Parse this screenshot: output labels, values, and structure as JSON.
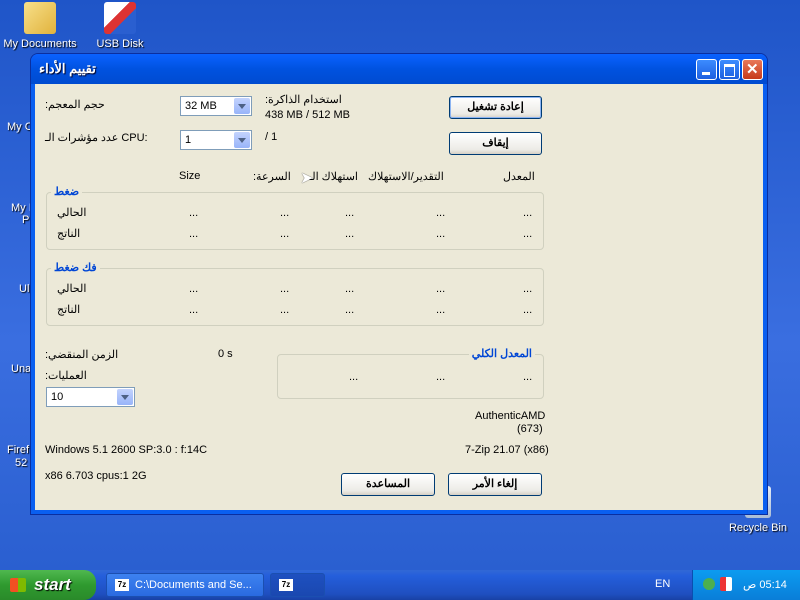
{
  "desktop": {
    "icons": [
      {
        "label": "My Documents"
      },
      {
        "label": "USB Disk"
      }
    ],
    "edge_labels": [
      "My C",
      "My I",
      "P",
      "Ul",
      "Una",
      "Firef",
      "52"
    ],
    "recycle_bin": "Recycle Bin"
  },
  "window": {
    "title": "تقييم الأداء",
    "dictionary_size_label": "حجم المعجم:",
    "dictionary_size_value": "32 MB",
    "memory_usage_label": "استخدام الذاكرة:",
    "memory_usage_value": "438 MB / 512 MB",
    "cpu_threads_label": "عدد مؤشرات الـ CPU:",
    "cpu_threads_value": "1",
    "cpu_threads_max": "/ 1",
    "restart_button": "إعادة تشغيل",
    "stop_button": "إيقاف",
    "columns": {
      "size": "Size",
      "speed": "السرعة:",
      "cpu_usage": "استهلاك الـ",
      "rating_usage": "التقدير/الاستهلاك",
      "rate": "المعدل"
    },
    "compress_group": {
      "title": "ضغط",
      "rows": [
        {
          "label": "الحالي",
          "cells": [
            "...",
            "...",
            "...",
            "...",
            "..."
          ]
        },
        {
          "label": "الناتج",
          "cells": [
            "...",
            "...",
            "...",
            "...",
            "..."
          ]
        }
      ]
    },
    "decompress_group": {
      "title": "فك ضغط",
      "rows": [
        {
          "label": "الحالي",
          "cells": [
            "...",
            "...",
            "...",
            "...",
            "..."
          ]
        },
        {
          "label": "الناتج",
          "cells": [
            "...",
            "...",
            "...",
            "...",
            "..."
          ]
        }
      ]
    },
    "elapsed_label": "الزمن المنقضي:",
    "elapsed_value": "0 s",
    "passes_label": "العمليات:",
    "passes_value": "10",
    "total_rating": {
      "title": "المعدل الكلي",
      "cells": [
        "...",
        "...",
        "..."
      ]
    },
    "cpu_vendor": "AuthenticAMD",
    "cpu_code": "(673)",
    "os_info": "Windows 5.1 2600 SP:3.0 :  f:14C",
    "version": "7-Zip 21.07 (x86)",
    "arch_info": "x86 6.703 cpus:1 2G",
    "help_button": "المساعدة",
    "cancel_button": "إلغاء الأمر"
  },
  "taskbar": {
    "start_label": "start",
    "tasks": [
      {
        "label": "C:\\Documents and Se..."
      },
      {
        "label": ""
      }
    ],
    "language": "EN",
    "clock": "05:14 ص"
  }
}
